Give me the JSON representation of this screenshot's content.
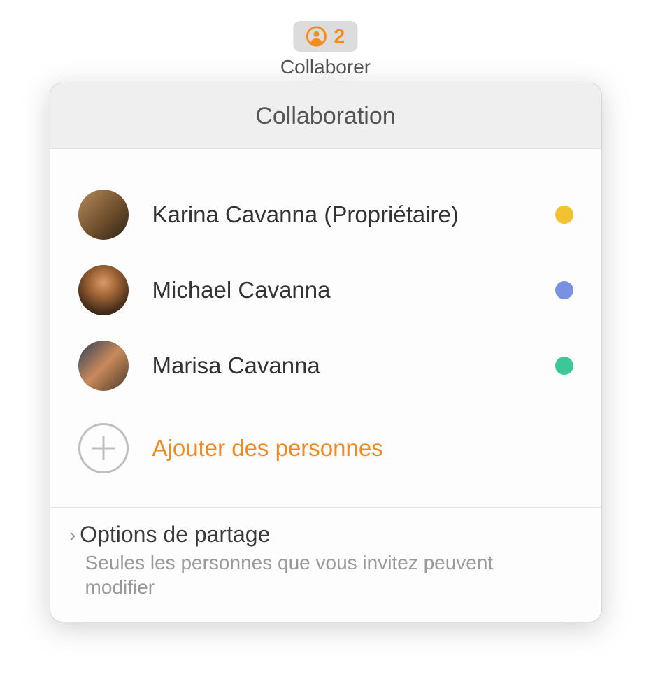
{
  "toolbar": {
    "count": "2",
    "label": "Collaborer",
    "icon_color": "#f58b1a"
  },
  "popover": {
    "title": "Collaboration",
    "people": [
      {
        "name": "Karina Cavanna (Propriétaire)",
        "status_color": "#f2c233"
      },
      {
        "name": "Michael Cavanna",
        "status_color": "#7a90e0"
      },
      {
        "name": "Marisa Cavanna",
        "status_color": "#3cc799"
      }
    ],
    "add_label": "Ajouter des personnes",
    "share": {
      "title": "Options de partage",
      "desc": "Seules les personnes que vous invitez peuvent modifier"
    }
  }
}
